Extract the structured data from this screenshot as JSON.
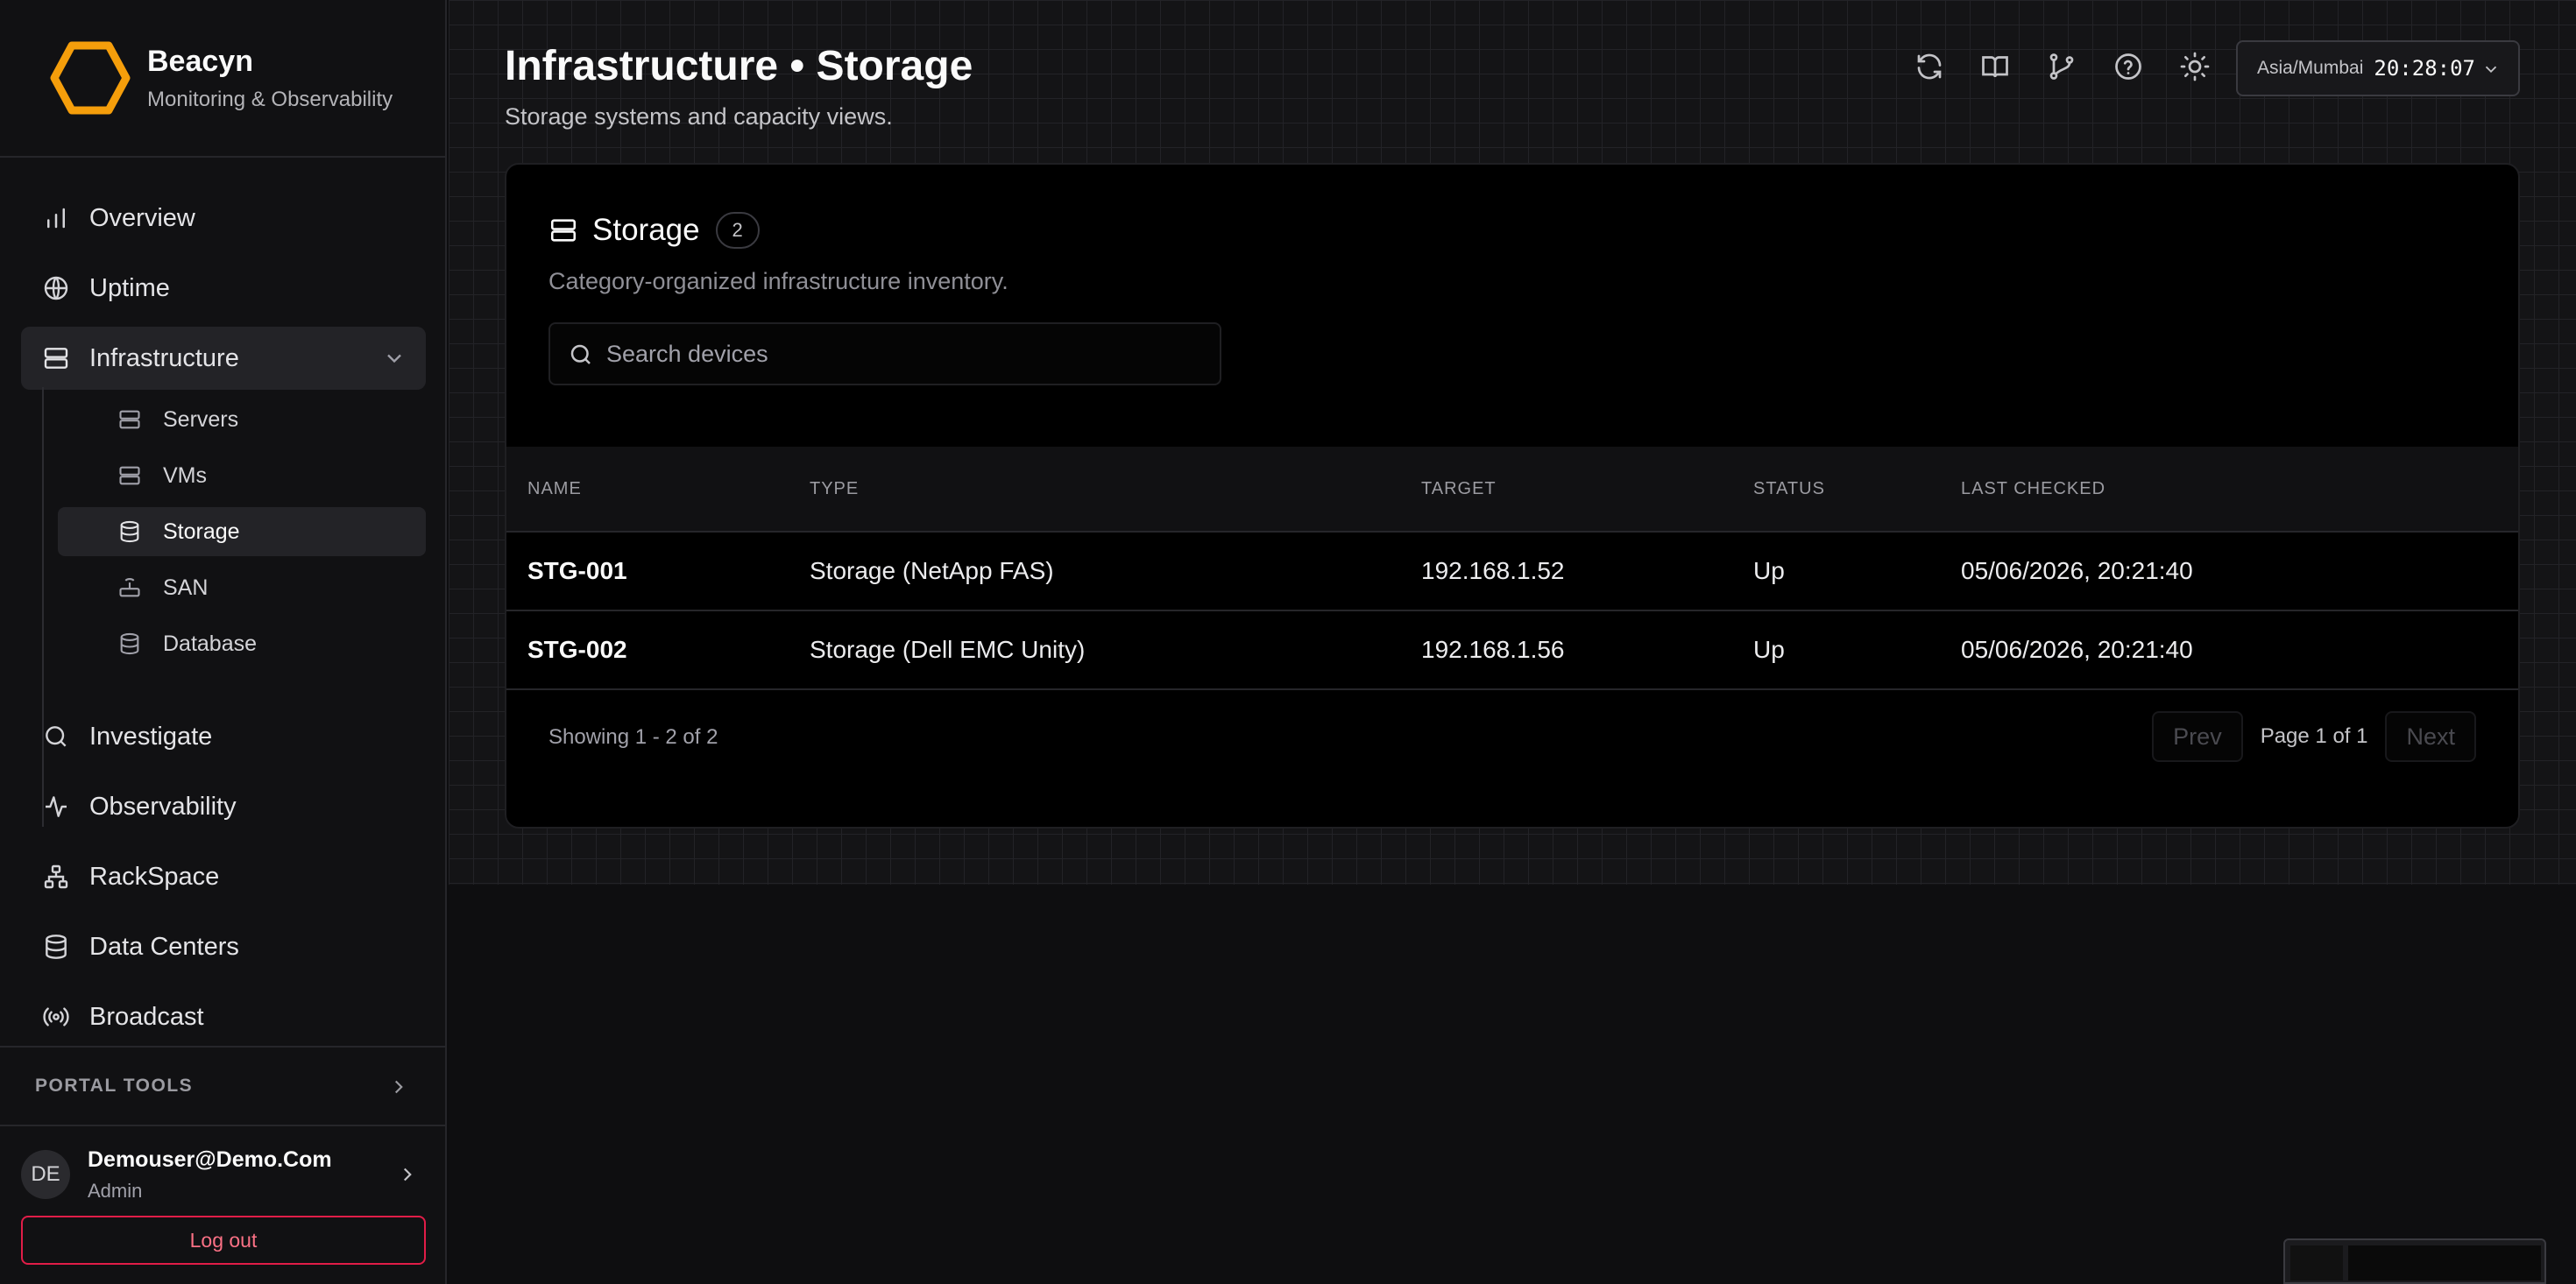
{
  "brand": {
    "name": "Beacyn",
    "subtitle": "Monitoring & Observability",
    "accent": "#f59e0b"
  },
  "nav": {
    "items": [
      {
        "label": "Overview",
        "icon": "bar-chart-icon"
      },
      {
        "label": "Uptime",
        "icon": "globe-icon"
      },
      {
        "label": "Infrastructure",
        "icon": "server-icon",
        "expanded": true
      },
      {
        "label": "Investigate",
        "icon": "search-icon"
      },
      {
        "label": "Observability",
        "icon": "activity-icon"
      },
      {
        "label": "RackSpace",
        "icon": "network-icon"
      },
      {
        "label": "Data Centers",
        "icon": "database-icon"
      },
      {
        "label": "Broadcast",
        "icon": "broadcast-icon"
      }
    ],
    "sub_items": [
      {
        "label": "Servers",
        "icon": "server-icon"
      },
      {
        "label": "VMs",
        "icon": "server-icon"
      },
      {
        "label": "Storage",
        "icon": "database-icon",
        "active": true
      },
      {
        "label": "SAN",
        "icon": "router-icon"
      },
      {
        "label": "Database",
        "icon": "database-icon"
      }
    ]
  },
  "portal_tools": {
    "label": "PORTAL TOOLS"
  },
  "user": {
    "initials": "DE",
    "name": "Demouser@Demo.Com",
    "role": "Admin",
    "logout": "Log out"
  },
  "header": {
    "title": "Infrastructure • Storage",
    "subtitle": "Storage systems and capacity views.",
    "icons": [
      "refresh-icon",
      "book-icon",
      "git-branch-icon",
      "help-icon",
      "sun-icon"
    ],
    "timezone": "Asia/Mumbai",
    "time": "20:28:07"
  },
  "card": {
    "title": "Storage",
    "count": "2",
    "subtitle": "Category-organized infrastructure inventory.",
    "search_placeholder": "Search devices",
    "columns": [
      "NAME",
      "TYPE",
      "TARGET",
      "STATUS",
      "LAST CHECKED"
    ],
    "rows": [
      {
        "name": "STG-001",
        "type": "Storage (NetApp FAS)",
        "target": "192.168.1.52",
        "status": "Up",
        "last_checked": "05/06/2026, 20:21:40"
      },
      {
        "name": "STG-002",
        "type": "Storage (Dell EMC Unity)",
        "target": "192.168.1.56",
        "status": "Up",
        "last_checked": "05/06/2026, 20:21:40"
      }
    ],
    "showing": "Showing 1 - 2 of 2",
    "prev": "Prev",
    "page_info": "Page 1 of 1",
    "next": "Next"
  }
}
